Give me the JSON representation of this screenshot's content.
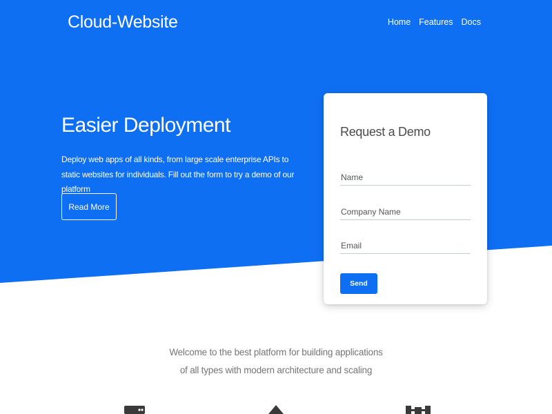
{
  "colors": {
    "hero_blue": "#0f6ff3",
    "white": "#ffffff",
    "muted_text": "#767676",
    "icon_dark": "#3a3a3a"
  },
  "navbar": {
    "brand": "Cloud-Website",
    "links": [
      {
        "label": "Home"
      },
      {
        "label": "Features"
      },
      {
        "label": "Docs"
      }
    ]
  },
  "hero": {
    "title": "Easier Deployment",
    "description": "Deploy web apps of all kinds, from large scale enterprise APIs to static websites for individuals. Fill out the form to try a demo of our platform",
    "button_label": "Read More"
  },
  "demo_form": {
    "title": "Request a Demo",
    "fields": {
      "name": {
        "placeholder": "Name"
      },
      "company": {
        "placeholder": "Company Name"
      },
      "email": {
        "placeholder": "Email"
      }
    },
    "submit_label": "Send"
  },
  "welcome": {
    "text": "Welcome to the best platform for building applications of all types with modern architecture and scaling"
  },
  "features": {
    "icons": [
      "server-icon",
      "triangle-icon",
      "network-icon"
    ]
  }
}
